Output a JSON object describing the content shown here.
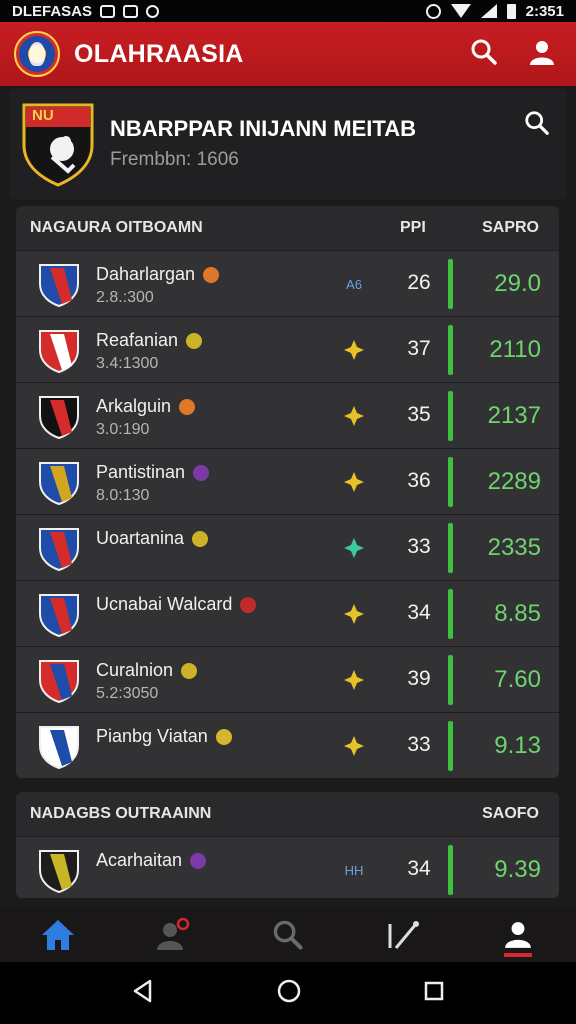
{
  "status_bar": {
    "left_text": "DLEFASAS",
    "time": "2:351"
  },
  "app_bar": {
    "title": "OLAHRAASIA"
  },
  "team": {
    "name": "NBARPPAR INIJANN MEITAB",
    "subtitle": "Frembbn: 1606",
    "crest_text": "NU"
  },
  "standings": {
    "header": {
      "title": "NAGAURA OITBOAMN",
      "pts_label": "PPI",
      "score_label": "SAPRO"
    },
    "rows": [
      {
        "name": "Daharlargan",
        "meta": "2.8.:300",
        "mid": "A6",
        "pts": "26",
        "score": "29.0",
        "shield_colors": [
          "#1f4ca8",
          "#d42b2b"
        ],
        "badge_color": "#e0782a"
      },
      {
        "name": "Reafanian",
        "meta": "3.4:1300",
        "mid": "",
        "pts": "37",
        "score": "2110",
        "shield_colors": [
          "#d42b2b",
          "#ffffff"
        ],
        "badge_color": "#cdb325"
      },
      {
        "name": "Arkalguin",
        "meta": "3.0:190",
        "mid": "",
        "pts": "35",
        "score": "2137",
        "shield_colors": [
          "#111111",
          "#d42b2b"
        ],
        "badge_color": "#e0782a"
      },
      {
        "name": "Pantistinan",
        "meta": "8.0:130",
        "mid": "",
        "pts": "36",
        "score": "2289",
        "shield_colors": [
          "#1f4ca8",
          "#d4a520"
        ],
        "badge_color": "#7c3aa8"
      },
      {
        "name": "Uoartanina",
        "meta": "",
        "mid": "",
        "pts": "33",
        "score": "2335",
        "shield_colors": [
          "#1f4ca8",
          "#d42b2b"
        ],
        "badge_color": "#cdb325"
      },
      {
        "name": "Ucnabai Walcard",
        "meta": "",
        "mid": "",
        "pts": "34",
        "score": "8.85",
        "shield_colors": [
          "#1f4ca8",
          "#d42b2b"
        ],
        "badge_color": "#c12a2a"
      },
      {
        "name": "Curalnion",
        "meta": "5.2:3050",
        "mid": "",
        "pts": "39",
        "score": "7.60",
        "shield_colors": [
          "#d42b2b",
          "#1f4ca8"
        ],
        "badge_color": "#cdb325"
      },
      {
        "name": "Pianbg Viatan",
        "meta": "",
        "mid": "",
        "pts": "33",
        "score": "9.13",
        "shield_colors": [
          "#ffffff",
          "#1f4ca8"
        ],
        "badge_color": "#d7b52c"
      }
    ]
  },
  "second_section": {
    "header": {
      "title": "NADAGBS OUTRAAINN",
      "score_label": "SAOFO"
    },
    "rows": [
      {
        "name": "Acarhaitan",
        "meta": "",
        "mid": "HH",
        "pts": "34",
        "score": "9.39",
        "shield_colors": [
          "#1d1d1d",
          "#c9b526"
        ],
        "badge_color": "#7c3aa8"
      }
    ]
  },
  "colors": {
    "accent": "#c81e22",
    "score_green": "#6ed46e",
    "bar_green": "#3fbf3f"
  }
}
